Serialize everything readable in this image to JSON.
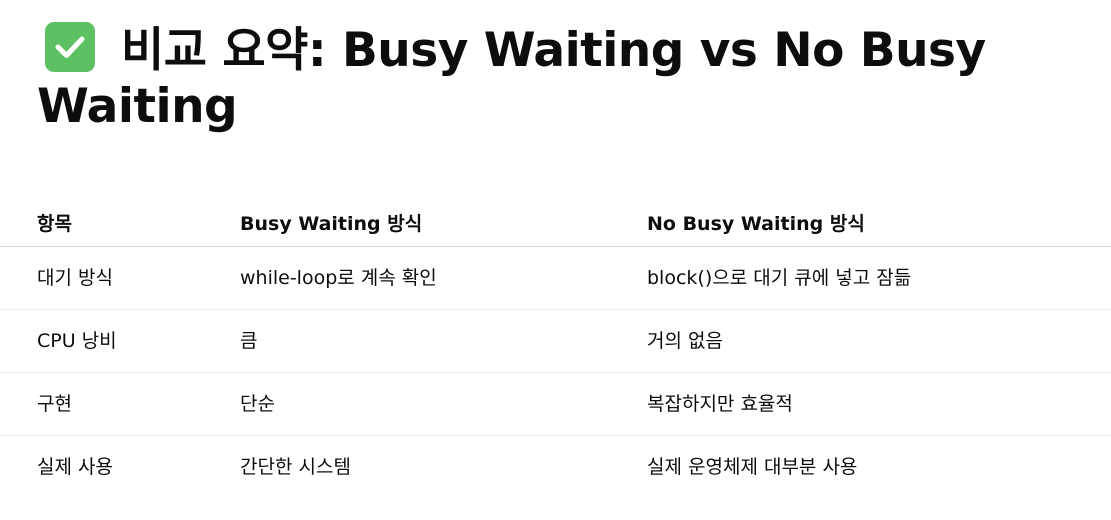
{
  "title": "비교 요약: Busy Waiting vs No Busy Waiting",
  "title_icon": "check-mark-button-icon",
  "colors": {
    "icon_background": "#5dc163",
    "text": "#0d0d0d"
  },
  "table": {
    "headers": [
      "항목",
      "Busy Waiting 방식",
      "No Busy Waiting 방식"
    ],
    "rows": [
      [
        "대기 방식",
        "while-loop로 계속 확인",
        "block()으로 대기 큐에 넣고 잠듦"
      ],
      [
        "CPU 낭비",
        "큼",
        "거의 없음"
      ],
      [
        "구현",
        "단순",
        "복잡하지만 효율적"
      ],
      [
        "실제 사용",
        "간단한 시스템",
        "실제 운영체제 대부분 사용"
      ]
    ]
  }
}
